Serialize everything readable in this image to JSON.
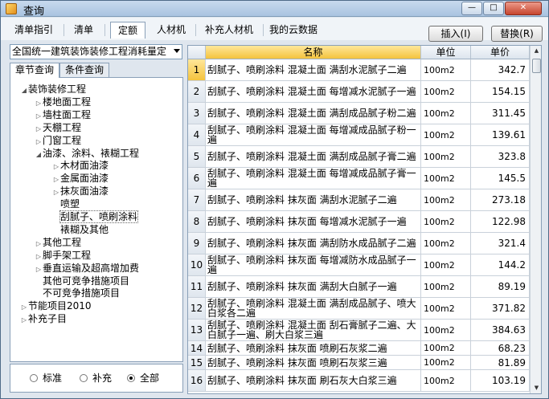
{
  "window": {
    "title": "查询"
  },
  "title_controls": {
    "minimize": "—",
    "maximize": "□",
    "close": "✕"
  },
  "top_tabs": [
    {
      "label": "清单指引"
    },
    {
      "label": "清单"
    },
    {
      "label": "定额",
      "active": true
    },
    {
      "label": "人材机"
    },
    {
      "label": "补充人材机"
    },
    {
      "label": "我的云数据"
    }
  ],
  "buttons": {
    "insert": "插入(I)",
    "replace": "替换(R)"
  },
  "library_select": {
    "value": "全国统一建筑装饰装修工程消耗量定"
  },
  "sub_tabs": [
    {
      "label": "章节查询",
      "active": true
    },
    {
      "label": "条件查询"
    }
  ],
  "tree": [
    {
      "label": "装饰装修工程",
      "level": 0,
      "expander": "open"
    },
    {
      "label": "楼地面工程",
      "level": 1,
      "expander": "closed"
    },
    {
      "label": "墙柱面工程",
      "level": 1,
      "expander": "closed"
    },
    {
      "label": "天棚工程",
      "level": 1,
      "expander": "closed"
    },
    {
      "label": "门窗工程",
      "level": 1,
      "expander": "closed"
    },
    {
      "label": "油漆、涂料、裱糊工程",
      "level": 1,
      "expander": "open"
    },
    {
      "label": "木材面油漆",
      "level": 2,
      "expander": "closed"
    },
    {
      "label": "金属面油漆",
      "level": 2,
      "expander": "closed"
    },
    {
      "label": "抹灰面油漆",
      "level": 2,
      "expander": "closed"
    },
    {
      "label": "喷塑",
      "level": 2,
      "expander": "none"
    },
    {
      "label": "刮腻子、喷刷涂料",
      "level": 2,
      "expander": "none",
      "selected": true
    },
    {
      "label": "裱糊及其他",
      "level": 2,
      "expander": "none"
    },
    {
      "label": "其他工程",
      "level": 1,
      "expander": "closed"
    },
    {
      "label": "脚手架工程",
      "level": 1,
      "expander": "closed"
    },
    {
      "label": "垂直运输及超高增加费",
      "level": 1,
      "expander": "closed"
    },
    {
      "label": "其他可竞争措施项目",
      "level": 1,
      "expander": "none"
    },
    {
      "label": "不可竞争措施项目",
      "level": 1,
      "expander": "none"
    },
    {
      "label": "节能项目2010",
      "level": 0,
      "expander": "closed"
    },
    {
      "label": "补充子目",
      "level": 0,
      "expander": "closed"
    }
  ],
  "filter": {
    "options": [
      {
        "label": "标准",
        "checked": false
      },
      {
        "label": "补充",
        "checked": false
      },
      {
        "label": "全部",
        "checked": true
      }
    ]
  },
  "table": {
    "columns": {
      "no": "",
      "name": "名称",
      "unit": "单位",
      "price": "单价"
    },
    "rows": [
      {
        "no": "1",
        "name": "刮腻子、喷刷涂料 混凝土面 满刮水泥腻子二遍",
        "unit": "100m2",
        "price": "342.7"
      },
      {
        "no": "2",
        "name": "刮腻子、喷刷涂料 混凝土面 每增减水泥腻子一遍",
        "unit": "100m2",
        "price": "154.15"
      },
      {
        "no": "3",
        "name": "刮腻子、喷刷涂料 混凝土面 满刮成品腻子粉二遍",
        "unit": "100m2",
        "price": "311.45"
      },
      {
        "no": "4",
        "name": "刮腻子、喷刷涂料 混凝土面 每增减成品腻子粉一遍",
        "unit": "100m2",
        "price": "139.61"
      },
      {
        "no": "5",
        "name": "刮腻子、喷刷涂料 混凝土面 满刮成品腻子膏二遍",
        "unit": "100m2",
        "price": "323.8"
      },
      {
        "no": "6",
        "name": "刮腻子、喷刷涂料 混凝土面 每增减成品腻子膏一遍",
        "unit": "100m2",
        "price": "145.5"
      },
      {
        "no": "7",
        "name": "刮腻子、喷刷涂料 抹灰面 满刮水泥腻子二遍",
        "unit": "100m2",
        "price": "273.18"
      },
      {
        "no": "8",
        "name": "刮腻子、喷刷涂料 抹灰面 每增减水泥腻子一遍",
        "unit": "100m2",
        "price": "122.98"
      },
      {
        "no": "9",
        "name": "刮腻子、喷刷涂料 抹灰面 满刮防水成品腻子二遍",
        "unit": "100m2",
        "price": "321.4"
      },
      {
        "no": "10",
        "name": "刮腻子、喷刷涂料 抹灰面 每增减防水成品腻子一遍",
        "unit": "100m2",
        "price": "144.2"
      },
      {
        "no": "11",
        "name": "刮腻子、喷刷涂料 抹灰面 满刮大白腻子一遍",
        "unit": "100m2",
        "price": "89.19"
      },
      {
        "no": "12",
        "name": "刮腻子、喷刷涂料 混凝土面 满刮成品腻子、喷大白浆各二遍",
        "unit": "100m2",
        "price": "371.82"
      },
      {
        "no": "13",
        "name": "刮腻子、喷刷涂料 混凝土面 刮石膏腻子二遍、大白腻子一遍、刷大白浆三遍",
        "unit": "100m2",
        "price": "384.63"
      },
      {
        "no": "14",
        "name": "刮腻子、喷刷涂料 抹灰面 喷刷石灰浆二遍",
        "unit": "100m2",
        "price": "68.23"
      },
      {
        "no": "15",
        "name": "刮腻子、喷刷涂料 抹灰面 喷刷石灰浆三遍",
        "unit": "100m2",
        "price": "81.89"
      },
      {
        "no": "16",
        "name": "刮腻子、喷刷涂料 抹灰面 刷石灰大白浆三遍",
        "unit": "100m2",
        "price": "103.19"
      }
    ]
  }
}
